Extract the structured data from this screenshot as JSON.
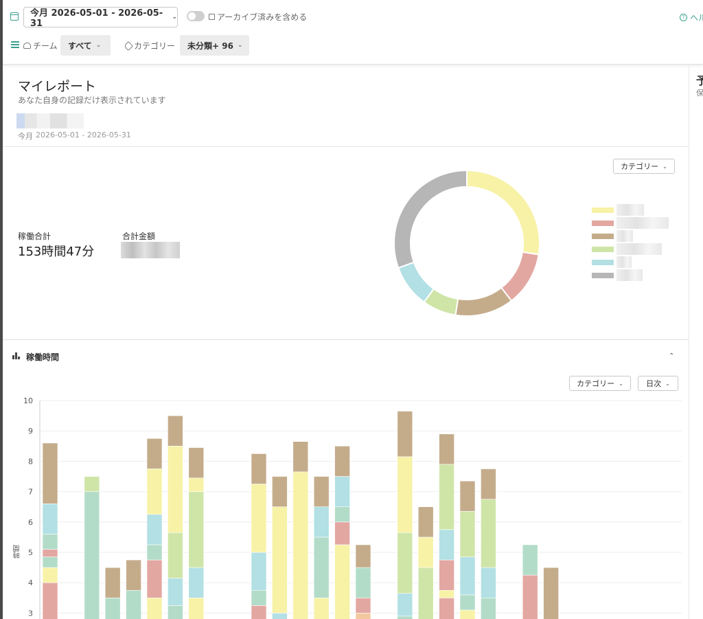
{
  "toolbar": {
    "date_range": "今月  2026-05-01 - 2026-05-31",
    "archive_label": "アーカイブ済みを含める",
    "help_label": "ヘルプ",
    "team_label": "チーム",
    "team_value": "すべて",
    "category_label": "カテゴリー",
    "category_value": "未分類+ 96"
  },
  "report": {
    "title": "マイレポート",
    "subtitle": "あなた自身の記録だけ表示されています",
    "period_label": "今月",
    "period_range": "2026-05-01 - 2026-05-31"
  },
  "side_panel": {
    "title": "予",
    "subtitle": "保"
  },
  "summary": {
    "total_label": "稼働合計",
    "total_value": "153時間47分",
    "amount_label": "合計金額"
  },
  "pie": {
    "group_by": "カテゴリー",
    "legend": [
      {
        "color": "#f7f2a6"
      },
      {
        "color": "#e3a7a2"
      },
      {
        "color": "#c4ac8b"
      },
      {
        "color": "#cfe5a8"
      },
      {
        "color": "#b2e0e4"
      },
      {
        "color": "#b6b6b6"
      }
    ]
  },
  "bar_section": {
    "title": "稼働時間",
    "group_by": "カテゴリー",
    "interval": "日次",
    "ylabel": "時間"
  },
  "chart_data": [
    {
      "type": "pie",
      "title": "",
      "values": [
        27.5,
        12,
        13,
        7.5,
        9.5,
        30.5
      ],
      "colors": [
        "#f7f2a6",
        "#e3a7a2",
        "#c4ac8b",
        "#cfe5a8",
        "#b2e0e4",
        "#b6b6b6"
      ]
    },
    {
      "type": "bar",
      "stacked": true,
      "ylabel": "時間",
      "ylim": [
        3,
        10
      ],
      "yticks": [
        3,
        4,
        5,
        6,
        7,
        8,
        9,
        10
      ],
      "day_indices": [
        1,
        2,
        3,
        4,
        5,
        6,
        7,
        8,
        9,
        10,
        11,
        12,
        13,
        14,
        15,
        16,
        17,
        18,
        19,
        20,
        21,
        22,
        23,
        24,
        25,
        26,
        27,
        28,
        29,
        30,
        31
      ],
      "days": [
        [
          {
            "c": "#e3a7a2",
            "v": 4
          },
          {
            "c": "#f7f2a6",
            "v": 0.5
          },
          {
            "c": "#b2dcc8",
            "v": 0.35
          },
          {
            "c": "#e3a7a2",
            "v": 0.25
          },
          {
            "c": "#b2dcc8",
            "v": 0.5
          },
          {
            "c": "#b2e0e4",
            "v": 1
          },
          {
            "c": "#c4ac8b",
            "v": 2
          }
        ],
        [],
        [
          {
            "c": "#b2dcc8",
            "v": 7
          },
          {
            "c": "#cfe5a8",
            "v": 0.5
          }
        ],
        [
          {
            "c": "#b2dcc8",
            "v": 3.5
          },
          {
            "c": "#c4ac8b",
            "v": 1
          }
        ],
        [
          {
            "c": "#b2dcc8",
            "v": 3.75
          },
          {
            "c": "#c4ac8b",
            "v": 1
          }
        ],
        [
          {
            "c": "#f7f2a6",
            "v": 3.5
          },
          {
            "c": "#e3a7a2",
            "v": 1.25
          },
          {
            "c": "#b2dcc8",
            "v": 0.5
          },
          {
            "c": "#b2e0e4",
            "v": 1
          },
          {
            "c": "#f7f2a6",
            "v": 1.5
          },
          {
            "c": "#c4ac8b",
            "v": 1
          }
        ],
        [
          {
            "c": "#b2dcc8",
            "v": 3.25
          },
          {
            "c": "#b2e0e4",
            "v": 0.9
          },
          {
            "c": "#cfe5a8",
            "v": 1.5
          },
          {
            "c": "#f7f2a6",
            "v": 2.85
          },
          {
            "c": "#c4ac8b",
            "v": 1
          }
        ],
        [
          {
            "c": "#f7f2a6",
            "v": 3.5
          },
          {
            "c": "#b2e0e4",
            "v": 1
          },
          {
            "c": "#cfe5a8",
            "v": 2.5
          },
          {
            "c": "#f7f2a6",
            "v": 0.45
          },
          {
            "c": "#c4ac8b",
            "v": 1
          }
        ],
        [],
        [],
        [
          {
            "c": "#e3a7a2",
            "v": 3.25
          },
          {
            "c": "#b2dcc8",
            "v": 0.5
          },
          {
            "c": "#b2e0e4",
            "v": 1.25
          },
          {
            "c": "#f7f2a6",
            "v": 2.25
          },
          {
            "c": "#c4ac8b",
            "v": 1
          }
        ],
        [
          {
            "c": "#b2e0e4",
            "v": 3
          },
          {
            "c": "#f7f2a6",
            "v": 3.5
          },
          {
            "c": "#c4ac8b",
            "v": 1
          }
        ],
        [
          {
            "c": "#f7f2a6",
            "v": 7.65
          },
          {
            "c": "#c4ac8b",
            "v": 1
          }
        ],
        [
          {
            "c": "#f7f2a6",
            "v": 3.5
          },
          {
            "c": "#b2dcc8",
            "v": 2
          },
          {
            "c": "#b2e0e4",
            "v": 1
          },
          {
            "c": "#c4ac8b",
            "v": 1
          }
        ],
        [
          {
            "c": "#f7f2a6",
            "v": 5.25
          },
          {
            "c": "#e3a7a2",
            "v": 0.75
          },
          {
            "c": "#b2dcc8",
            "v": 0.5
          },
          {
            "c": "#b2e0e4",
            "v": 1
          },
          {
            "c": "#c4ac8b",
            "v": 1
          }
        ],
        [
          {
            "c": "#f3c89f",
            "v": 3
          },
          {
            "c": "#e3a7a2",
            "v": 0.5
          },
          {
            "c": "#b2dcc8",
            "v": 1
          },
          {
            "c": "#c4ac8b",
            "v": 0.75
          }
        ],
        [],
        [
          {
            "c": "#b2dcc8",
            "v": 2.9
          },
          {
            "c": "#b2e0e4",
            "v": 0.75
          },
          {
            "c": "#cfe5a8",
            "v": 2
          },
          {
            "c": "#f7f2a6",
            "v": 2.5
          },
          {
            "c": "#c4ac8b",
            "v": 1.5
          }
        ],
        [
          {
            "c": "#cfe5a8",
            "v": 4.5
          },
          {
            "c": "#f7f2a6",
            "v": 1
          },
          {
            "c": "#c4ac8b",
            "v": 1
          }
        ],
        [
          {
            "c": "#e3a7a2",
            "v": 3.5
          },
          {
            "c": "#f7f2a6",
            "v": 0.25
          },
          {
            "c": "#e3a7a2",
            "v": 1
          },
          {
            "c": "#b2e0e4",
            "v": 1
          },
          {
            "c": "#cfe5a8",
            "v": 2.15
          },
          {
            "c": "#c4ac8b",
            "v": 1
          }
        ],
        [
          {
            "c": "#f7f2a6",
            "v": 3.1
          },
          {
            "c": "#b2dcc8",
            "v": 0.5
          },
          {
            "c": "#b2e0e4",
            "v": 1.25
          },
          {
            "c": "#cfe5a8",
            "v": 1.5
          },
          {
            "c": "#c4ac8b",
            "v": 1
          }
        ],
        [
          {
            "c": "#b2dcc8",
            "v": 3.5
          },
          {
            "c": "#b2e0e4",
            "v": 1
          },
          {
            "c": "#cfe5a8",
            "v": 2.25
          },
          {
            "c": "#c4ac8b",
            "v": 1
          }
        ],
        [],
        [
          {
            "c": "#e3a7a2",
            "v": 4.25
          },
          {
            "c": "#b2dcc8",
            "v": 1
          }
        ],
        [
          {
            "c": "#c4ac8b",
            "v": 4.5
          }
        ],
        [],
        [],
        [],
        [],
        [],
        []
      ]
    }
  ]
}
